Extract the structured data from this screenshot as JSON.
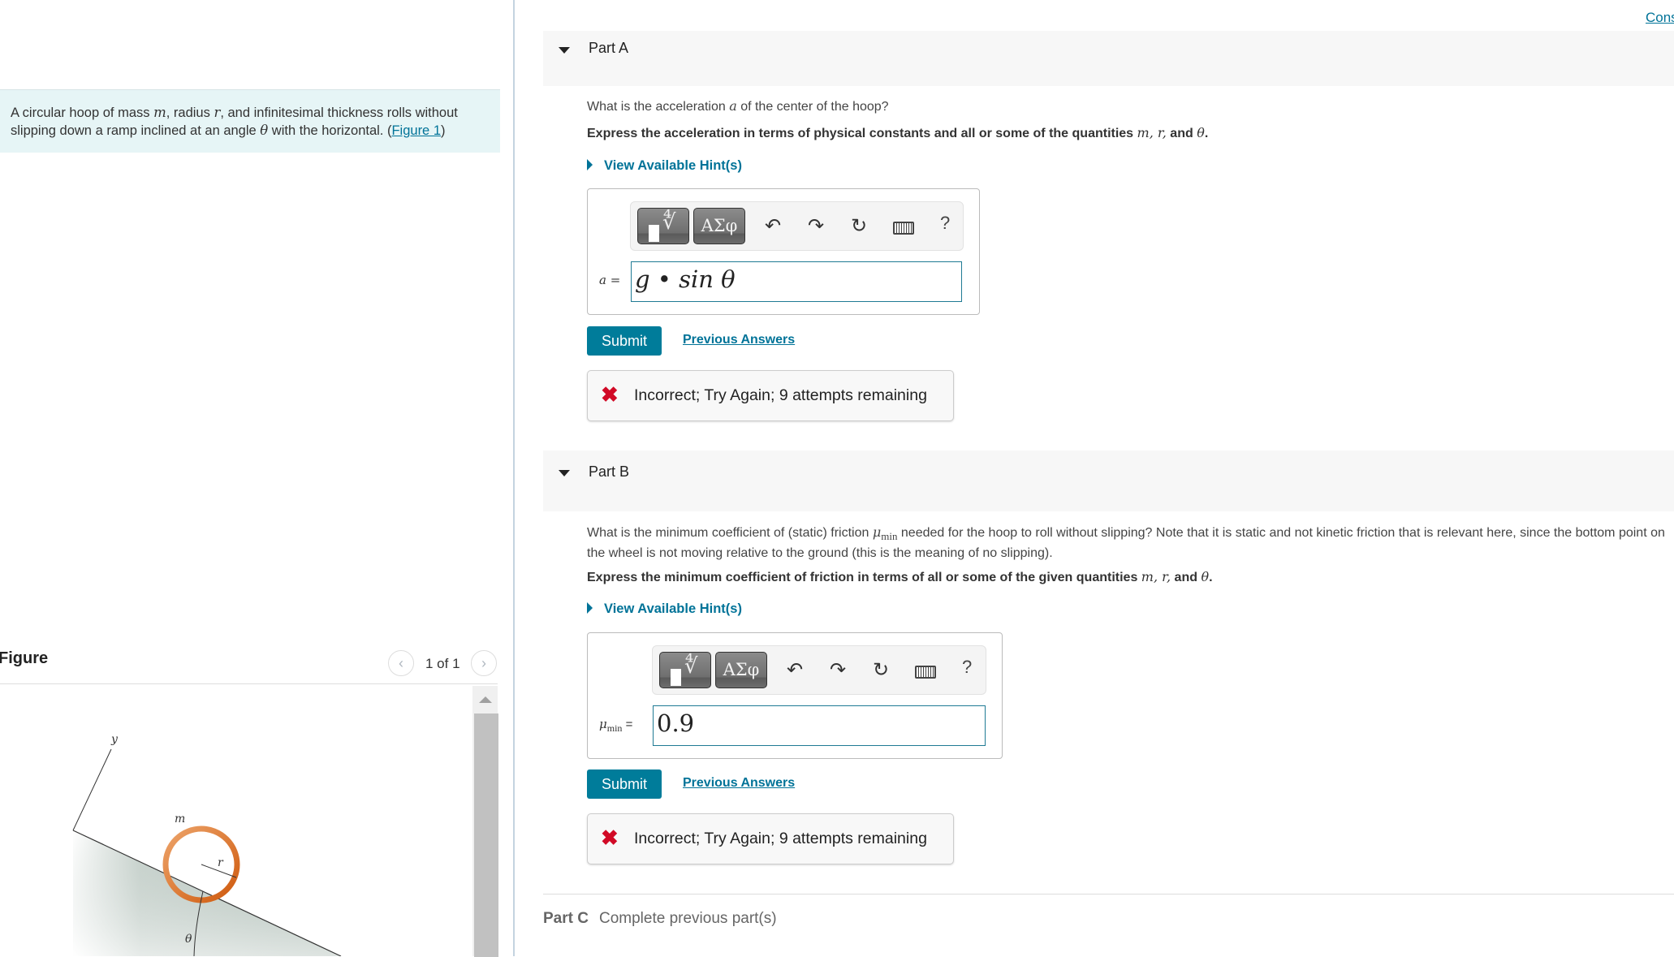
{
  "header": {
    "cons_link": "Cons"
  },
  "problem": {
    "text_1": "A circular hoop of mass ",
    "var_m": "m",
    "text_2": ", radius ",
    "var_r": "r",
    "text_3": ", and infinitesimal thickness rolls without slipping down a ramp inclined at an angle ",
    "var_theta": "θ",
    "text_4": " with the horizontal. (",
    "figure_link": "Figure 1",
    "text_5": ")"
  },
  "figure": {
    "title": "Figure",
    "pager": "1 of 1",
    "labels": {
      "y_axis": "y",
      "mass": "m",
      "radius": "r",
      "angle": "θ"
    },
    "colors": {
      "hoop": "#d96a1f",
      "ramp": "#b4c2bb"
    }
  },
  "part_a": {
    "label": "Part A",
    "question_1": "What is the acceleration ",
    "question_var": "a",
    "question_2": " of the center of the hoop?",
    "instruction_1": "Express the acceleration in terms of physical constants and all or some of the quantities ",
    "instruction_vars": "m, r,",
    "instruction_2": " and ",
    "instruction_var_theta": "θ",
    "instruction_3": ".",
    "hint_link": "View Available Hint(s)",
    "answer_label": "a =",
    "answer_value": "g • sin θ",
    "submit": "Submit",
    "previous_answers": "Previous Answers",
    "feedback": "Incorrect; Try Again; 9 attempts remaining"
  },
  "part_b": {
    "label": "Part B",
    "question_1": "What is the minimum coefficient of (static) friction ",
    "question_var": "μ",
    "question_var_sub": "min",
    "question_2": " needed for the hoop to roll without slipping? Note that it is static and not kinetic friction that is relevant here, since the bottom point on the wheel is not moving relative to the ground (this is the meaning of no slipping).",
    "instruction_1": "Express the minimum coefficient of friction in terms of all or some of the given quantities ",
    "instruction_vars": "m, r,",
    "instruction_2": " and ",
    "instruction_var_theta": "θ",
    "instruction_3": ".",
    "hint_link": "View Available Hint(s)",
    "answer_label_var": "μ",
    "answer_label_sub": "min",
    "answer_label_eq": " =",
    "answer_value": "0.9",
    "submit": "Submit",
    "previous_answers": "Previous Answers",
    "feedback": "Incorrect; Try Again; 9 attempts remaining"
  },
  "part_c": {
    "label": "Part C",
    "status": "Complete previous part(s)"
  },
  "toolbar": {
    "templates_icon": "▮∜□",
    "greek_label": "ΑΣφ",
    "undo_icon": "↶",
    "redo_icon": "↷",
    "reset_icon": "↻",
    "help_label": "?"
  },
  "colors": {
    "accent": "#007c9a",
    "link": "#007398",
    "error": "#d10a26",
    "problem_bg": "#e6f5f6",
    "part_header_bg": "#f7f7f7"
  }
}
